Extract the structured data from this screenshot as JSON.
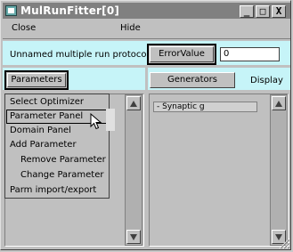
{
  "window": {
    "title": "MulRunFitter[0]",
    "controls": {
      "minimize": "_",
      "maximize": "□",
      "close": "X"
    }
  },
  "menu": {
    "close": "Close",
    "hide": "Hide"
  },
  "protocol": {
    "label": "Unnamed multiple run protocol",
    "error_button": "ErrorValue",
    "error_value": "0"
  },
  "left_header": {
    "parameters_button": "Parameters"
  },
  "right_header": {
    "generators_button": "Generators",
    "display_label": "Display"
  },
  "parameters_menu": {
    "items": [
      {
        "label": "Select Optimizer",
        "indent": false
      },
      {
        "label": "Parameter Panel",
        "indent": false,
        "highlighted": true
      },
      {
        "label": "Domain Panel",
        "indent": false
      },
      {
        "label": "Add Parameter",
        "indent": false
      },
      {
        "label": "Remove Parameter",
        "indent": true
      },
      {
        "label": "Change Parameter",
        "indent": true
      },
      {
        "label": "Parm import/export",
        "indent": false
      }
    ]
  },
  "generators_list": {
    "items": [
      "- Synaptic g"
    ]
  },
  "icons": {
    "app": "window-app-icon",
    "scroll_up": "arrow-up-icon",
    "scroll_down": "arrow-down-icon",
    "cursor": "mouse-pointer-icon",
    "resize": "resize-grip-icon"
  },
  "colors": {
    "protocol_row_bg": "#c6f4f8",
    "title_bg": "#808080",
    "window_bg": "#c0c0c0"
  }
}
